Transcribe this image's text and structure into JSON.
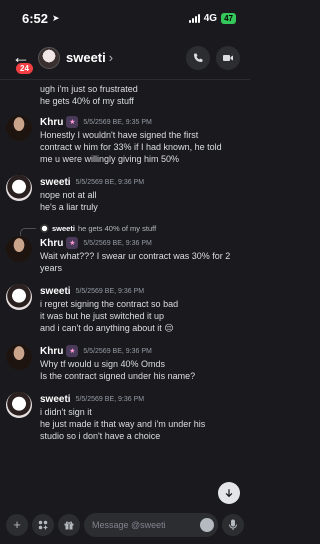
{
  "status_bar": {
    "time": "6:52",
    "network": "4G",
    "battery": "47"
  },
  "header": {
    "unread_count": "24",
    "name": "sweeti"
  },
  "messages": [
    {
      "continuation": true,
      "lines": [
        "ugh i'm just so frustrated",
        "he gets 40% of my stuff"
      ]
    },
    {
      "author": "Khru",
      "avatar": "khru",
      "time": "5/5/2569 BE, 9:35 PM",
      "lines": [
        "Honestly I wouldn't have signed the first",
        "contract w him for 33% if I had known, he told",
        "me u were willingly giving him 50%"
      ]
    },
    {
      "author": "sweeti",
      "avatar": "sweeti",
      "time": "5/5/2569 BE, 9:36 PM",
      "lines": [
        "nope not at all",
        "he's a liar truly"
      ]
    },
    {
      "reply_to": {
        "name": "sweeti",
        "text": "he gets 40% of my stuff"
      },
      "author": "Khru",
      "avatar": "khru",
      "time": "5/5/2569 BE, 9:36 PM",
      "lines": [
        "Wait what??? I swear ur contract was 30% for 2",
        "years"
      ]
    },
    {
      "author": "sweeti",
      "avatar": "sweeti",
      "time": "5/5/2569 BE, 9:36 PM",
      "lines": [
        "i regret signing the contract so bad",
        "it was but he just switched it up",
        "and i can't do anything about it 😔"
      ]
    },
    {
      "author": "Khru",
      "avatar": "khru",
      "time": "5/5/2569 BE, 9:36 PM",
      "lines": [
        "Why tf would u sign 40% Omds",
        "Is the contract signed under his name?"
      ]
    },
    {
      "author": "sweeti",
      "avatar": "sweeti",
      "time": "5/5/2569 BE, 9:36 PM",
      "lines": [
        "i didn't sign it",
        "he just made it that way and i'm under his",
        "studio so i don't have a choice"
      ]
    }
  ],
  "composer": {
    "placeholder": "Message @sweeti"
  },
  "icons": {
    "back": "arrow-left-icon",
    "call": "phone-icon",
    "video": "video-camera-icon",
    "add": "plus-icon",
    "apps": "apps-icon",
    "gift": "gift-icon",
    "emoji": "emoji-icon",
    "mic": "microphone-icon",
    "scroll": "arrow-down-icon"
  }
}
